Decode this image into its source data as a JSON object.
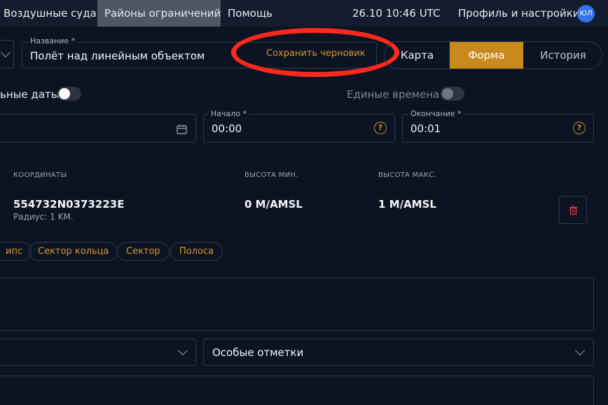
{
  "nav": {
    "items": [
      {
        "label": "Воздушные суда"
      },
      {
        "label": "Районы ограничений"
      },
      {
        "label": "Помощь"
      }
    ],
    "datetime": "26.10 10:46 UTC",
    "profile_label": "Профиль и настройки",
    "avatar_initials": "ЮЛ"
  },
  "form": {
    "name_label": "Название *",
    "name_value": "Полёт над линейным объектом",
    "save_draft_label": "Сохранить черновик"
  },
  "tabs": [
    {
      "label": "Карта"
    },
    {
      "label": "Форма",
      "active": true
    },
    {
      "label": "История"
    }
  ],
  "toggles": {
    "dates_label": "ьные даты",
    "dates_on": true,
    "single_times_label": "Единые времена",
    "single_times_on": false
  },
  "time": {
    "start_label": "Начало *",
    "start_value": "00:00",
    "end_label": "Окончание *",
    "end_value": "00:01"
  },
  "zone_table": {
    "headers": {
      "coordinates": "КООРДИНАТЫ",
      "alt_min": "ВЫСОТА МИН.",
      "alt_max": "ВЫСОТА МАКС."
    },
    "row": {
      "coordinates": "554732N0373223E",
      "radius": "Радиус: 1 KM.",
      "alt_min": "0 M/AMSL",
      "alt_max": "1 M/AMSL"
    }
  },
  "shape_chips": [
    {
      "label": "ипс"
    },
    {
      "label": "Сектор кольца"
    },
    {
      "label": "Сектор"
    },
    {
      "label": "Полоса"
    }
  ],
  "special_marks": {
    "placeholder": "Особые отметки"
  },
  "colors": {
    "background": "#0c1424",
    "accent": "#c98a1d",
    "highlight_ring": "#ff2a1c",
    "avatar": "#3573e8",
    "delete": "#e03a3a"
  }
}
